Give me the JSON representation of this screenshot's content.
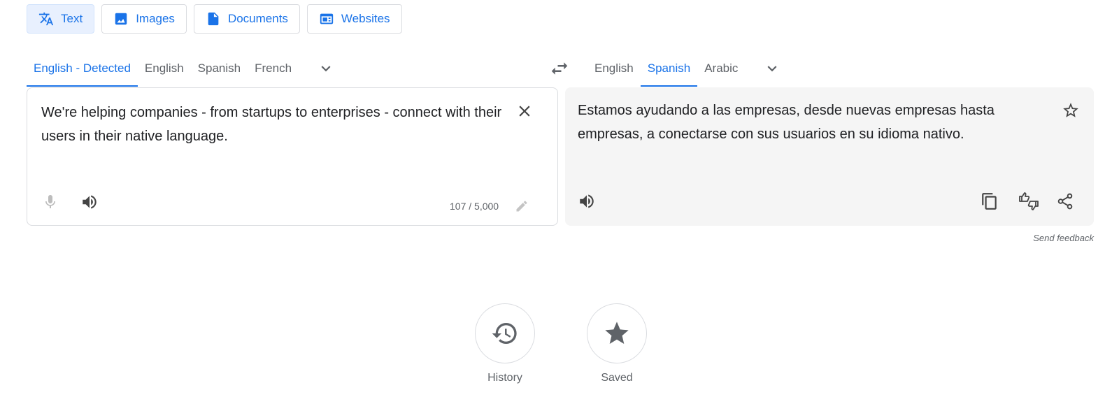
{
  "modes": [
    {
      "label": "Text",
      "icon": "translate-icon",
      "active": true
    },
    {
      "label": "Images",
      "icon": "image-icon",
      "active": false
    },
    {
      "label": "Documents",
      "icon": "document-icon",
      "active": false
    },
    {
      "label": "Websites",
      "icon": "website-icon",
      "active": false
    }
  ],
  "source": {
    "languages": [
      "English - Detected",
      "English",
      "Spanish",
      "French"
    ],
    "active_index": 0,
    "text": "We're helping companies - from startups to enterprises - connect with their users in their native language.",
    "char_count": "107 / 5,000"
  },
  "target": {
    "languages": [
      "English",
      "Spanish",
      "Arabic"
    ],
    "active_index": 1,
    "text": "Estamos ayudando a las empresas, desde nuevas empresas hasta empresas, a conectarse con sus usuarios en su idioma nativo."
  },
  "send_feedback": "Send feedback",
  "bottom": {
    "history_label": "History",
    "saved_label": "Saved"
  },
  "colors": {
    "accent": "#1a73e8",
    "icon_gray": "#5f6368",
    "target_bg": "#f5f5f5"
  }
}
